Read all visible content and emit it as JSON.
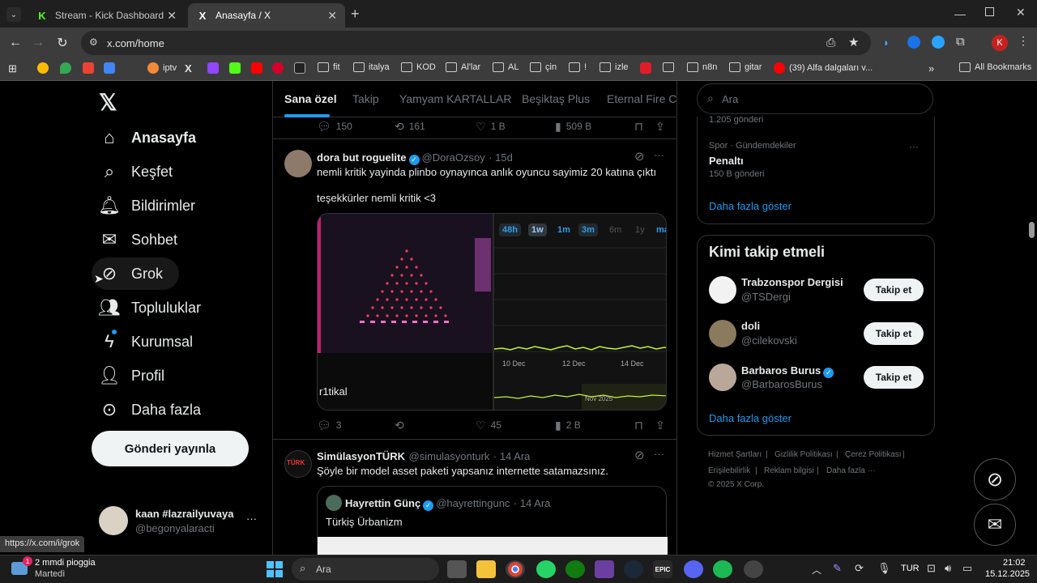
{
  "browser": {
    "tabs": [
      {
        "title": "Stream - Kick Dashboard",
        "favicon": "K",
        "color": "#53fc18"
      },
      {
        "title": "Anasayfa / X",
        "favicon": "X",
        "color": "#ffffff"
      }
    ],
    "new_tab": "+",
    "url": "x.com/home",
    "profile_initial": "K",
    "bookmarks": [
      "iptv",
      "fit",
      "italya",
      "KOD",
      "Al'lar",
      "AL",
      "çin",
      "!",
      "izle",
      "n8n",
      "gitar",
      "(39) Alfa dalgaları v..."
    ],
    "all_bookmarks": "All Bookmarks",
    "status_url": "https://x.com/i/grok"
  },
  "nav": {
    "items": [
      "Anasayfa",
      "Keşfet",
      "Bildirimler",
      "Sohbet",
      "Grok",
      "Topluluklar",
      "Kurumsal",
      "Profil",
      "Daha fazla"
    ],
    "post_button": "Gönderi yayınla",
    "account_name": "kaan #lazrailyuvaya",
    "account_handle": "@begonyalaracti",
    "more": "···"
  },
  "timeline": {
    "tabs": [
      "Sana özel",
      "Takip",
      "Yamyam KARTALLAR",
      "Beşiktaş Plus",
      "Eternal Fire Co"
    ],
    "prev_stats": {
      "replies": "150",
      "reposts": "161",
      "likes": "1 B",
      "views": "509 B"
    },
    "tweet1": {
      "name": "dora but roguelite",
      "handle": "@DoraOzsoy",
      "time": "· 15d",
      "text1": "nemli kritik yayinda plinbo oynayınca anlık oyuncu sayimiz 20 katına çıktı",
      "text2": "teşekkürler nemli kritik <3",
      "media_caption": "r1tikal",
      "chart_tabs": [
        "48h",
        "1w",
        "1m",
        "3m",
        "6m",
        "1y",
        "max"
      ],
      "chart_dates": [
        "10 Dec",
        "12 Dec",
        "14 Dec"
      ],
      "chart_mini_label": "Nov 2025",
      "stats": {
        "replies": "3",
        "reposts": "",
        "likes": "45",
        "views": "2 B"
      }
    },
    "tweet2": {
      "name": "SimülasyonTÜRK",
      "handle": "@simulasyonturk",
      "time": "· 14 Ara",
      "text": "Şöyle bir model asset paketi yapsanız internette satamazsınız.",
      "quote_name": "Hayrettin Günç",
      "quote_handle": "@hayrettingunc",
      "quote_time": "· 14 Ara",
      "quote_text": "Türkiş Ürbanizm"
    }
  },
  "sidebar": {
    "search_placeholder": "Ara",
    "trend_prev_count": "1.205 gönderi",
    "trend_category": "Spor · Gündemdekiler",
    "trend_title": "Penaltı",
    "trend_count": "150 B gönderi",
    "show_more": "Daha fazla göster",
    "who_to_follow_title": "Kimi takip etmeli",
    "suggestions": [
      {
        "name": "Trabzonspor Dergisi",
        "handle": "@TSDergi",
        "verified": false
      },
      {
        "name": "doli",
        "handle": "@cilekovski",
        "verified": false
      },
      {
        "name": "Barbaros Burus",
        "handle": "@BarbarosBurus",
        "verified": true
      }
    ],
    "follow_label": "Takip et",
    "show_more2": "Daha fazla göster",
    "footer": [
      "Hizmet Şartları",
      "Gizlilik Politikası",
      "Çerez Politikası",
      "Erişilebilirlik",
      "Reklam bilgisi",
      "Daha fazla ···"
    ],
    "copyright": "© 2025 X Corp."
  },
  "taskbar": {
    "weather": "2 mmdi pioggia",
    "day": "Martedì",
    "search": "Ara",
    "lang": "TUR",
    "time": "21:02",
    "date": "15.12.2025",
    "weather_badge": "1"
  }
}
